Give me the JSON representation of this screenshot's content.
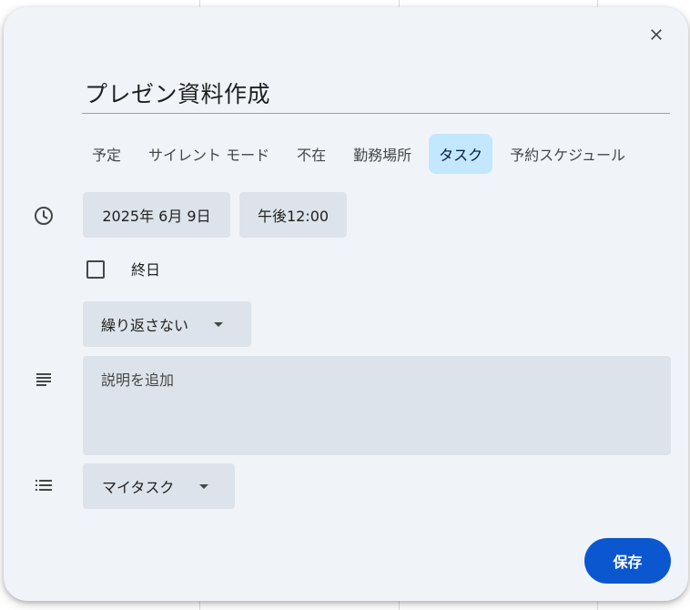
{
  "dialog": {
    "title": "プレゼン資料作成",
    "tabs": [
      {
        "label": "予定",
        "active": false
      },
      {
        "label": "サイレント モード",
        "active": false
      },
      {
        "label": "不在",
        "active": false
      },
      {
        "label": "勤務場所",
        "active": false
      },
      {
        "label": "タスク",
        "active": true
      },
      {
        "label": "予約スケジュール",
        "active": false
      }
    ],
    "date": "2025年 6月 9日",
    "time": "午後12:00",
    "all_day_label": "終日",
    "all_day_checked": false,
    "repeat": "繰り返さない",
    "description_placeholder": "説明を追加",
    "task_list": "マイタスク",
    "save_label": "保存"
  },
  "colors": {
    "dialog_bg": "#f0f4f9",
    "chip_bg": "#dde3ea",
    "active_tab_bg": "#c2e7ff",
    "primary": "#0b57d0"
  },
  "icons": {
    "close": "close-icon",
    "time": "clock-icon",
    "description": "notes-icon",
    "task_list": "list-icon"
  }
}
